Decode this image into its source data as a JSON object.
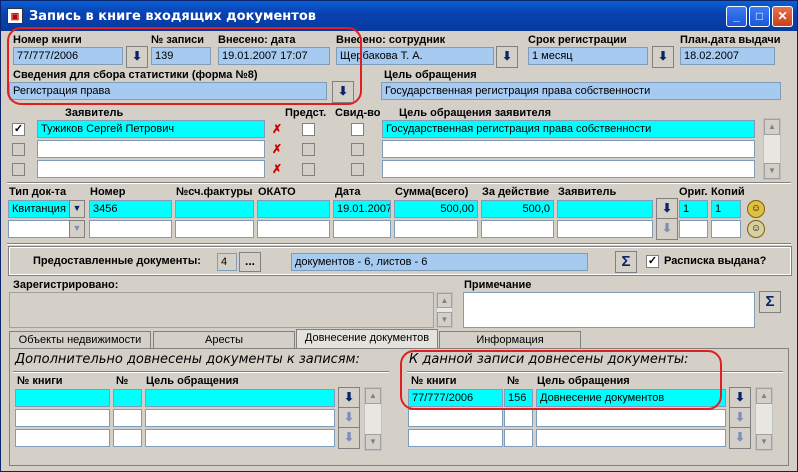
{
  "window": {
    "title": "Запись в книге входящих документов"
  },
  "top": {
    "book_no_label": "Номер книги",
    "book_no": "77/777/2006",
    "rec_no_label": "№ записи",
    "rec_no": "139",
    "entered_date_label": "Внесено: дата",
    "entered_date": "19.01.2007 17:07",
    "entered_by_label": "Внесено: сотрудник",
    "entered_by": "Щербакова Т. А.",
    "term_label": "Срок регистрации",
    "term": "1 месяц",
    "plan_date_label": "План.дата выдачи",
    "plan_date": "18.02.2007",
    "stats_label": "Сведения для сбора статистики (форма №8)",
    "stats": "Регистрация права",
    "purpose_label": "Цель обращения",
    "purpose": "Государственная регистрация права собственности"
  },
  "applicants": {
    "col_applicant": "Заявитель",
    "col_repr": "Предст.",
    "col_cert": "Свид-во",
    "col_purpose": "Цель обращения заявителя",
    "rows": [
      {
        "name": "Тужиков Сергей Петрович",
        "purpose": "Государственная регистрация права собственности",
        "checked": "✓"
      },
      {
        "name": "",
        "purpose": "",
        "checked": ""
      },
      {
        "name": "",
        "purpose": "",
        "checked": ""
      }
    ]
  },
  "docs": {
    "col_type": "Тип док-та",
    "col_number": "Номер",
    "col_invoice": "№сч.фактуры",
    "col_okato": "ОКАТО",
    "col_date": "Дата",
    "col_sum": "Сумма(всего)",
    "col_action": "За действие",
    "col_applicant": "Заявитель",
    "col_orig": "Ориг.",
    "col_copies": "Копий",
    "row": {
      "type": "Квитанция",
      "number": "3456",
      "invoice": "",
      "okato": "",
      "date": "19.01.2007",
      "sum": "500,00",
      "action": "500,0",
      "applicant": "",
      "orig": "1",
      "copies": "1"
    }
  },
  "provided": {
    "label": "Предоставленные документы:",
    "count": "4",
    "more": "...",
    "summary": "документов - 6, листов - 6",
    "receipt_label": "Расписка выдана?",
    "receipt_checked": "✓"
  },
  "registered": {
    "label": "Зарегистрировано:",
    "note_label": "Примечание"
  },
  "tabs": [
    "Объекты недвижимости",
    "Аресты",
    "Довнесение документов",
    "Информация"
  ],
  "additional": {
    "left_title": "Дополнительно довнесены документы к записям:",
    "right_title": "К данной записи довнесены документы:",
    "col_book": "№ книги",
    "col_no": "№",
    "col_purpose": "Цель обращения",
    "right_row": {
      "book": "77/777/2006",
      "no": "156",
      "purpose": "Довнесение документов"
    }
  },
  "icons": {
    "dropdown": "arrow-down-icon",
    "sigma": "sigma-icon",
    "delete": "delete-person-icon",
    "smile": "smiley-icon"
  }
}
